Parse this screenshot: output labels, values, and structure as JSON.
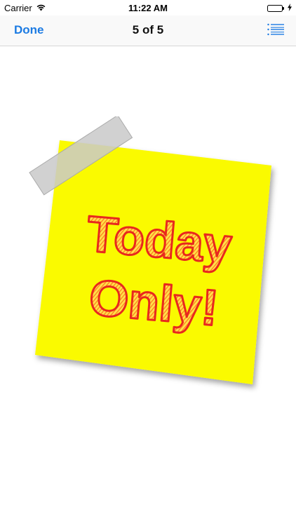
{
  "status_bar": {
    "carrier": "Carrier",
    "time": "11:22 AM",
    "battery_level": 1.0,
    "icons": [
      "wifi-icon",
      "battery-icon",
      "charging-bolt-icon"
    ]
  },
  "nav": {
    "done_label": "Done",
    "title": "5 of 5",
    "list_icon": "list-icon"
  },
  "image": {
    "line1": "Today",
    "line2": "Only!",
    "note_color": "#fafa00",
    "text_color": "#e8281e",
    "tape_color": "#c9c9c9"
  },
  "colors": {
    "accent": "#1c7be3",
    "battery": "#4cd964"
  }
}
